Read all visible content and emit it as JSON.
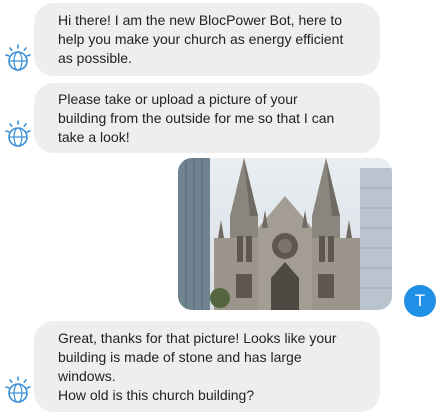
{
  "bot": {
    "avatar_icon": "ibm-watson-bot-icon",
    "accent_color": "#3b8fd8"
  },
  "messages": [
    {
      "sender": "bot",
      "lines": [
        "Hi there! I am the new BlocPower Bot, here to",
        "help you make your church as energy efficient",
        "as possible."
      ]
    },
    {
      "sender": "bot",
      "lines": [
        "Please take or upload a picture of your",
        "building from the outside for me so that I can",
        "take a look!"
      ]
    },
    {
      "sender": "user",
      "attachment": "cathedral-photo"
    },
    {
      "sender": "bot",
      "lines": [
        "Great, thanks for that picture! Looks like your",
        "building is made of stone and has large",
        "windows.",
        "How old is this church building?"
      ]
    }
  ],
  "user": {
    "initial": "T",
    "avatar_color": "#1e90e6"
  }
}
